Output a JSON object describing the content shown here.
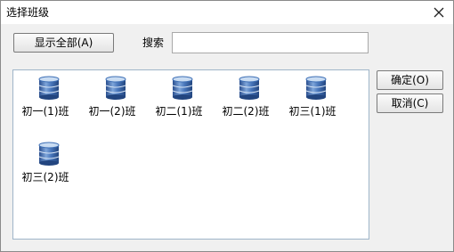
{
  "window": {
    "title": "选择班级",
    "close_symbol": "✕"
  },
  "toolbar": {
    "show_all_label": "显示全部(A)",
    "search_label": "搜索",
    "search_value": "",
    "search_placeholder": ""
  },
  "classes": [
    {
      "label": "初一(1)班",
      "icon": "database-icon"
    },
    {
      "label": "初一(2)班",
      "icon": "database-icon"
    },
    {
      "label": "初二(1)班",
      "icon": "database-icon"
    },
    {
      "label": "初二(2)班",
      "icon": "database-icon"
    },
    {
      "label": "初三(1)班",
      "icon": "database-icon"
    },
    {
      "label": "初三(2)班",
      "icon": "database-icon"
    }
  ],
  "actions": {
    "ok_label": "确定(O)",
    "cancel_label": "取消(C)"
  },
  "colors": {
    "icon_blue": "#3e6fb5",
    "icon_light": "#c9dcf2",
    "panel_border": "#9fb5c9",
    "dialog_bg": "#f0f0f0"
  }
}
